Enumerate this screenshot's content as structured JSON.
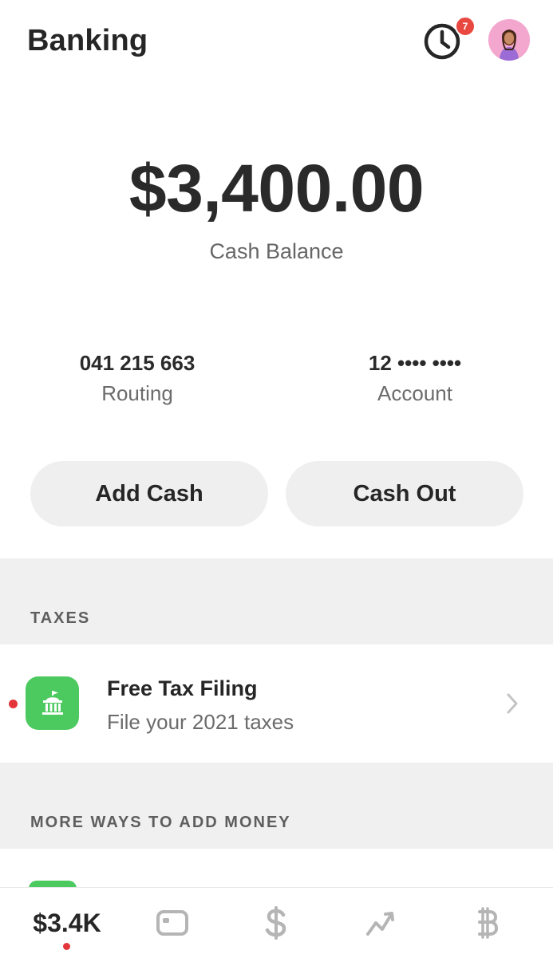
{
  "header": {
    "title": "Banking",
    "notification_count": "7",
    "activity_icon": "clock-icon",
    "avatar_icon": "profile-avatar"
  },
  "balance": {
    "amount": "$3,400.00",
    "label": "Cash Balance"
  },
  "account_info": {
    "routing_number": "041 215 663",
    "routing_label": "Routing",
    "account_number": "12 •••• ••••",
    "account_label": "Account"
  },
  "actions": {
    "add_cash": "Add Cash",
    "cash_out": "Cash Out"
  },
  "sections": {
    "taxes_header": "TAXES",
    "tax_item": {
      "title": "Free Tax Filing",
      "subtitle": "File your 2021 taxes",
      "icon": "government-building-icon"
    },
    "more_header": "MORE WAYS TO ADD MONEY"
  },
  "tab_bar": {
    "balance_label": "$3.4K",
    "tabs": [
      "balance",
      "card-icon",
      "dollar-icon",
      "investing-icon",
      "bitcoin-icon"
    ]
  },
  "colors": {
    "accent_green": "#4cc95f",
    "badge_red": "#e8483f",
    "pill_bg": "#efefef",
    "section_bg": "#f0f0f0"
  }
}
